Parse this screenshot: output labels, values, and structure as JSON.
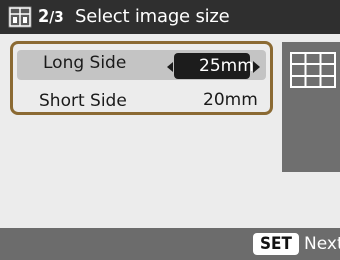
{
  "header": {
    "page_current": "2",
    "page_total": "/3",
    "title": "Select image size",
    "mode_icon": "photo-grid-icon"
  },
  "settings": {
    "rows": [
      {
        "label": "Long Side",
        "value": "25mm",
        "selected": true
      },
      {
        "label": "Short Side",
        "value": "20mm",
        "selected": false
      }
    ]
  },
  "preview": {
    "icon": "layout-grid-icon"
  },
  "footer": {
    "set_label": "SET",
    "next_label": "Next"
  },
  "colors": {
    "title_bar": "#2f2f2f",
    "panel_border": "#8b6a33",
    "selected_row": "#c4c4c4",
    "value_box": "#1c1c1c",
    "bottom_bar": "#6c6c6c",
    "preview_panel": "#6f6f6f"
  }
}
